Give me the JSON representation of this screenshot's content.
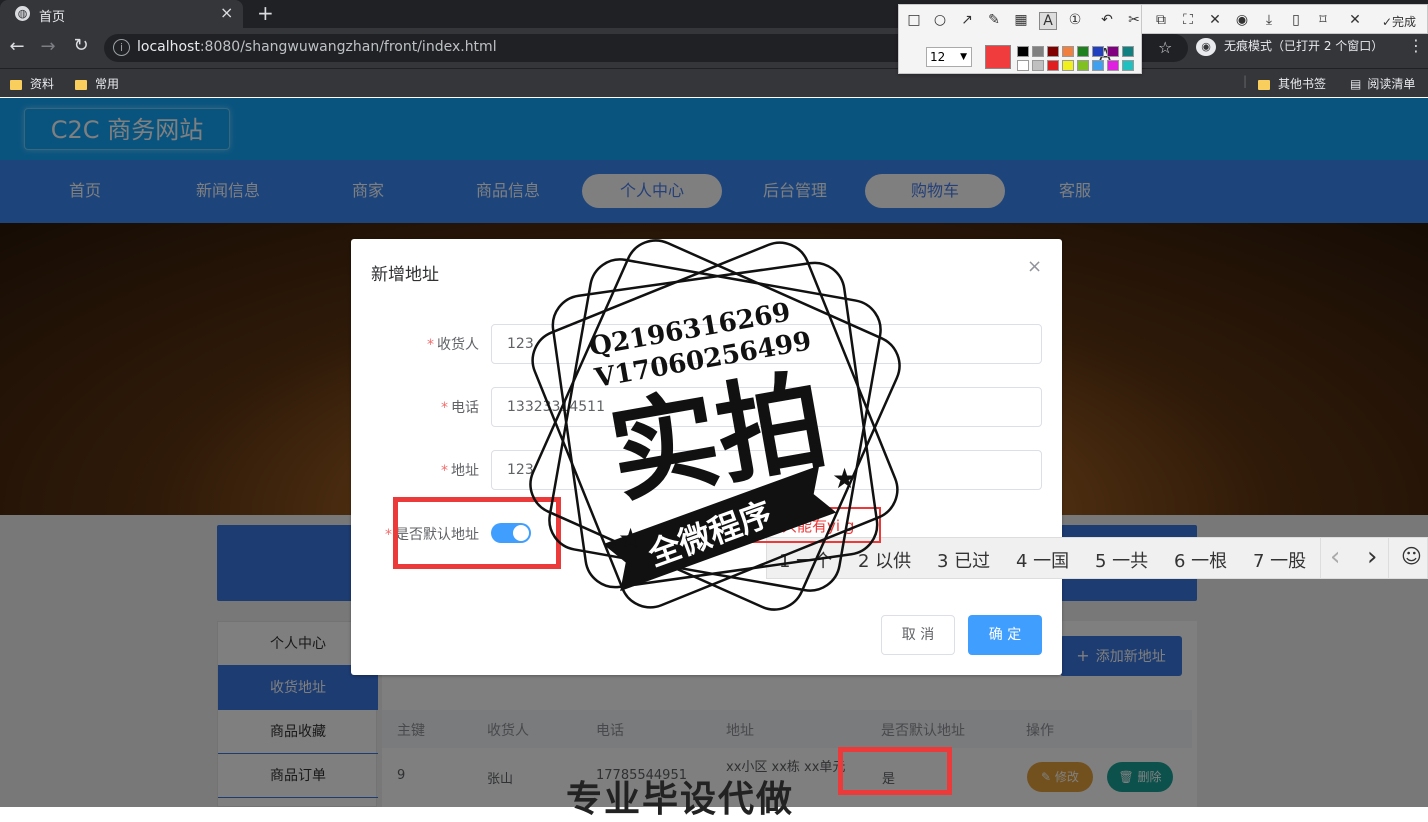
{
  "browser": {
    "tab_title": "首页",
    "new_tab": "+",
    "url_host": "localhost",
    "url_path": ":8080/shangwuwangzhan/front/index.html",
    "incognito_label": "无痕模式（已打开 2 个窗口）",
    "bookmarks": [
      "资料",
      "常用"
    ],
    "bookmarks_right": [
      "其他书签",
      "阅读清单"
    ]
  },
  "screenshot_tool": {
    "font_size": "12",
    "done_label": "完成",
    "selected_color": "#f03c3c",
    "palette_row1": [
      "#000000",
      "#808080",
      "#800000",
      "#f08040",
      "#208020",
      "#2040c0",
      "#800080",
      "#108080"
    ],
    "palette_row2": [
      "#ffffff",
      "#c0c0c0",
      "#e02020",
      "#f0f020",
      "#80c020",
      "#40a0f0",
      "#e020e0",
      "#20c0c0"
    ]
  },
  "site": {
    "logo": "C2C 商务网站",
    "nav": [
      {
        "label": "首页",
        "active": false
      },
      {
        "label": "新闻信息",
        "active": false
      },
      {
        "label": "商家",
        "active": false
      },
      {
        "label": "商品信息",
        "active": false
      },
      {
        "label": "个人中心",
        "active": true
      },
      {
        "label": "后台管理",
        "active": false
      },
      {
        "label": "购物车",
        "active": true
      },
      {
        "label": "客服",
        "active": false
      }
    ],
    "side_menu": [
      {
        "label": "个人中心",
        "active": false
      },
      {
        "label": "收货地址",
        "active": true
      },
      {
        "label": "商品收藏",
        "active": false
      },
      {
        "label": "商品订单",
        "active": false
      }
    ],
    "add_button": "添加新地址",
    "table": {
      "headers": [
        "主键",
        "收货人",
        "电话",
        "地址",
        "是否默认地址",
        "操作"
      ],
      "row": {
        "id": "9",
        "name": "张山",
        "phone": "17785544951",
        "address": "xx小区 xx栋 xx单元",
        "is_default": "是"
      },
      "edit_label": "修改",
      "delete_label": "删除"
    }
  },
  "dialog": {
    "title": "新增地址",
    "close": "×",
    "fields": [
      {
        "label": "收货人",
        "value": "123"
      },
      {
        "label": "电话",
        "value": "13323314511"
      },
      {
        "label": "地址",
        "value": "123"
      },
      {
        "label": "是否默认地址",
        "value": ""
      }
    ],
    "default_on": true,
    "cancel": "取 消",
    "ok": "确 定"
  },
  "ime": {
    "candidates": [
      "1 一个",
      "2 以供",
      "3 已过",
      "4 一国",
      "5 一共",
      "6 一根",
      "7 一股"
    ],
    "prev": "‹",
    "next": "›",
    "emoji": "☺"
  },
  "annotation": {
    "hint_text": "部只能有yi g"
  },
  "watermark": {
    "line1": "Q2196316269",
    "line2": "V17060256499",
    "main": "实拍",
    "ribbon": "全微程序",
    "bottom": "专业毕设代做"
  }
}
